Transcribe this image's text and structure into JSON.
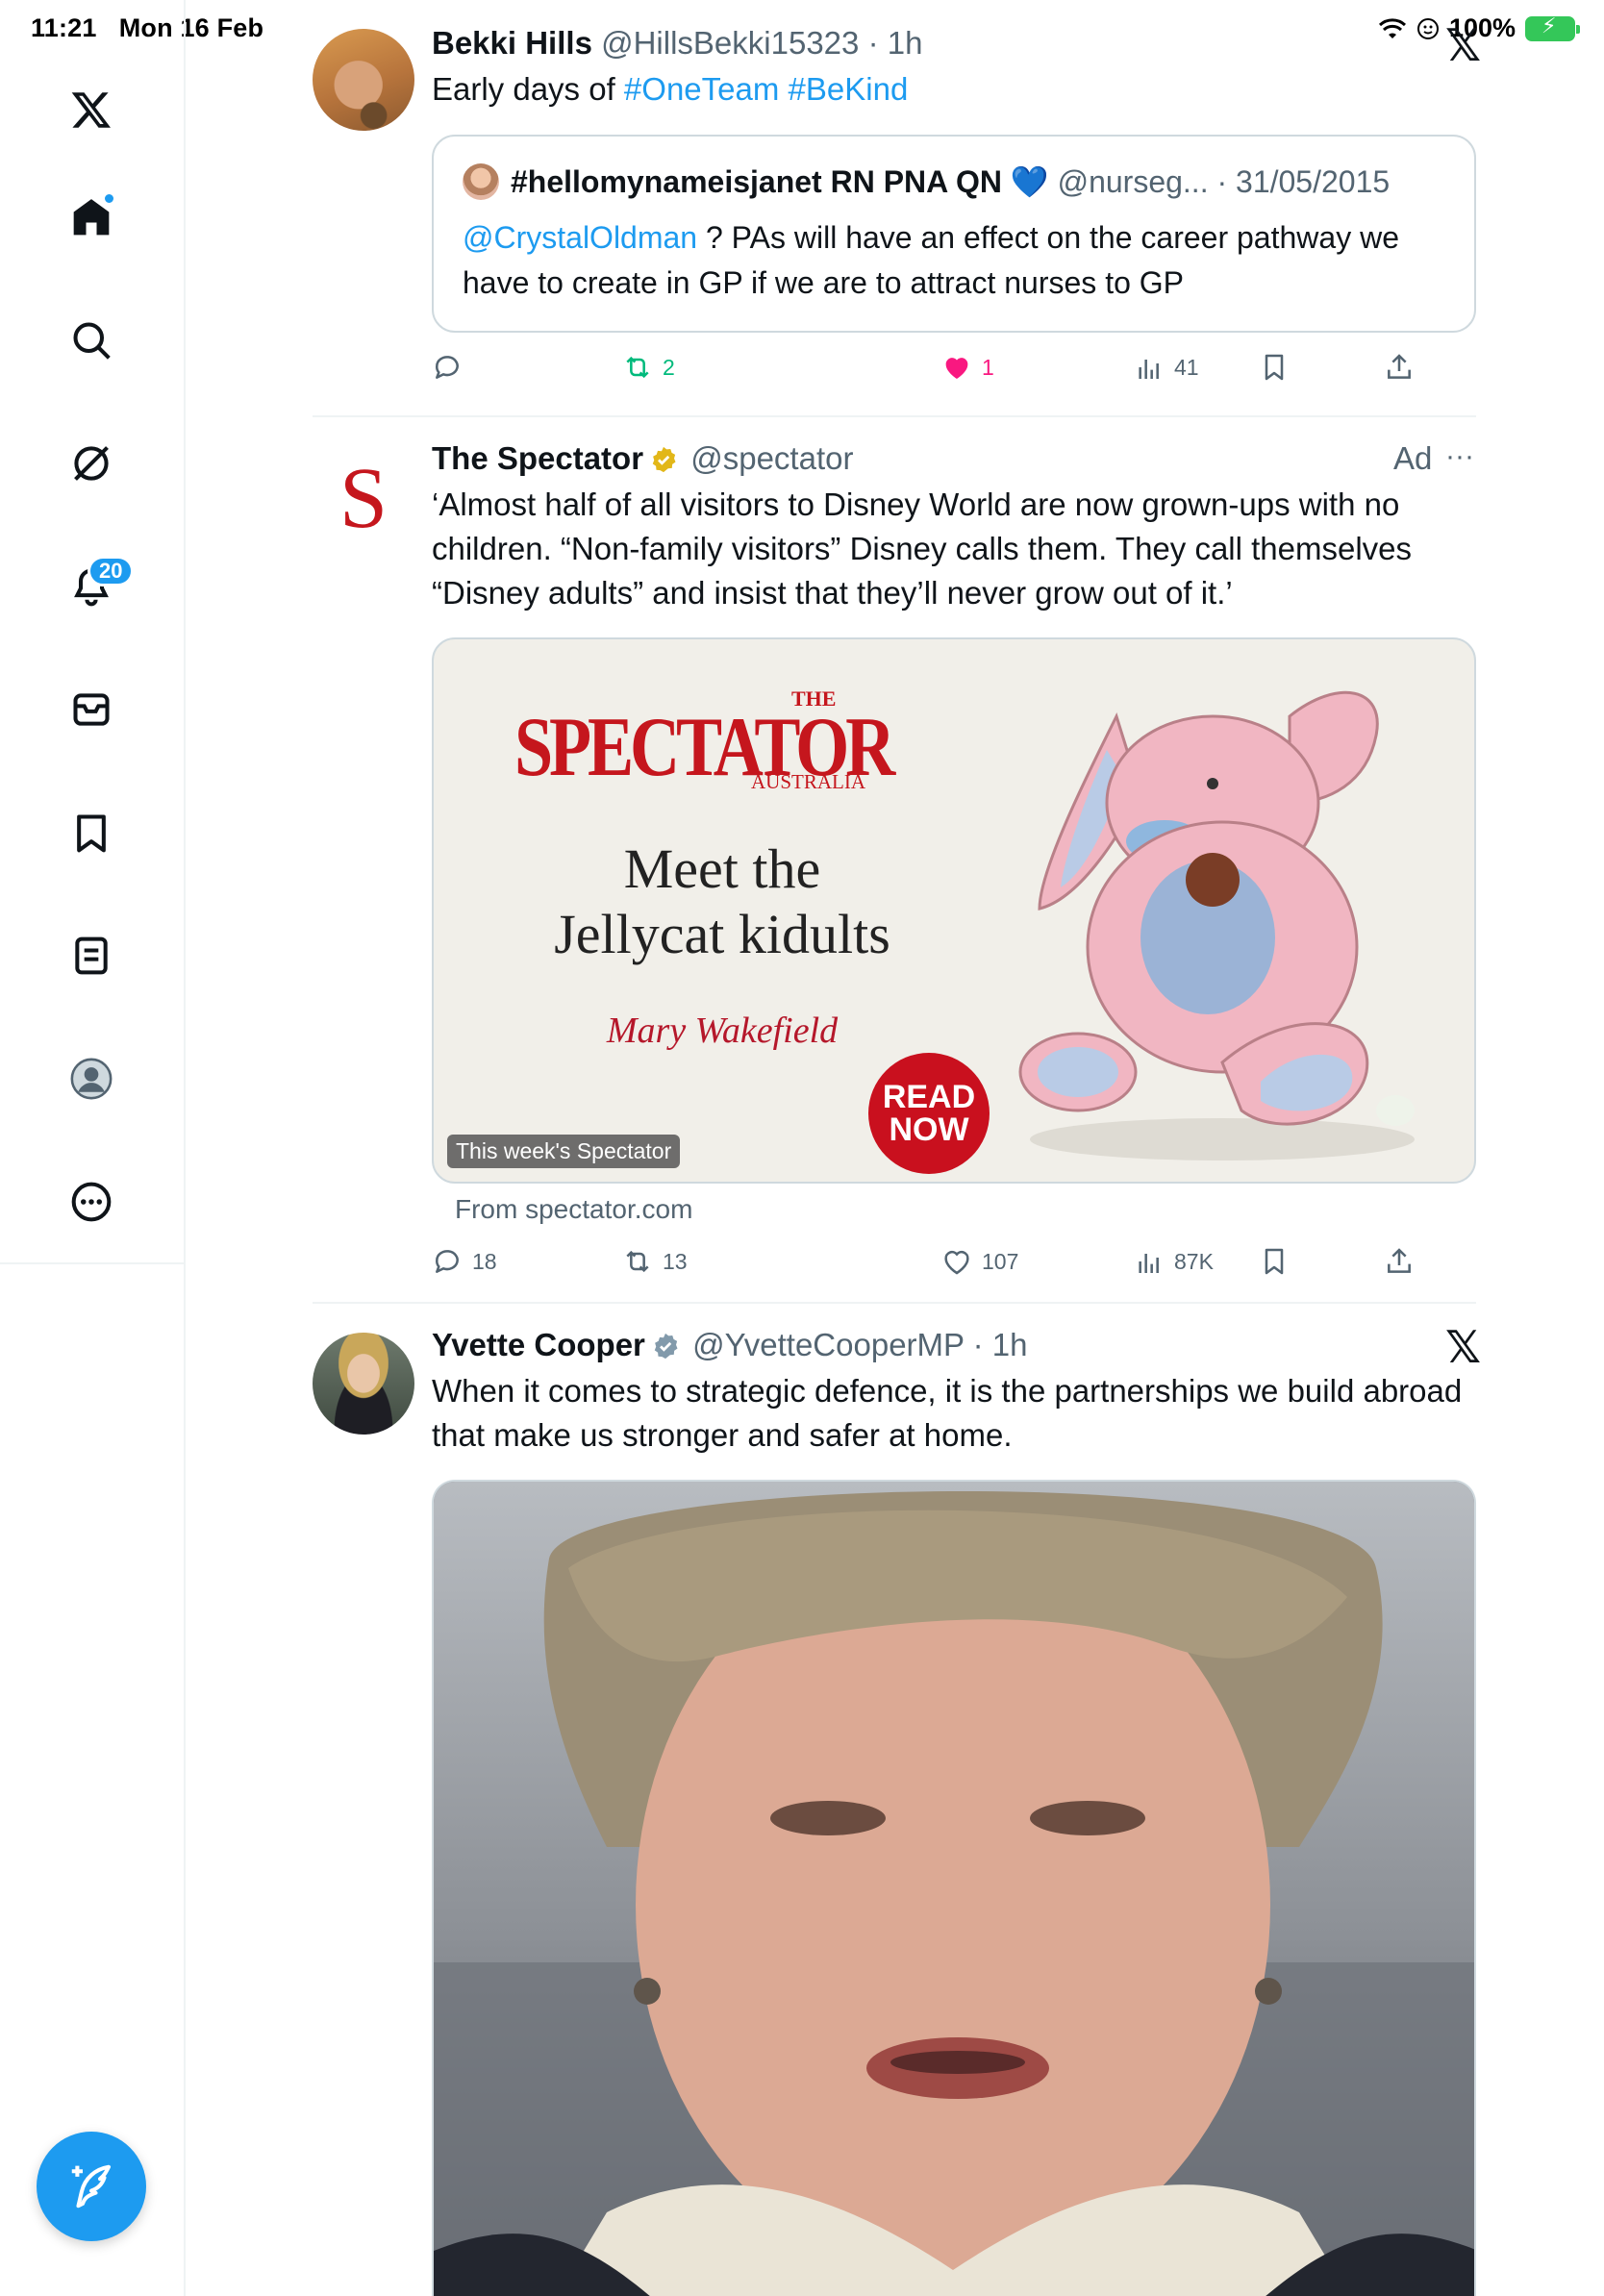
{
  "status_bar": {
    "time": "11:21",
    "date": "Mon 16 Feb",
    "battery": "100%"
  },
  "sidebar": {
    "items": [
      {
        "name": "x-logo"
      },
      {
        "name": "home"
      },
      {
        "name": "explore"
      },
      {
        "name": "grok"
      },
      {
        "name": "notifications",
        "badge": "20"
      },
      {
        "name": "messages"
      },
      {
        "name": "bookmarks"
      },
      {
        "name": "lists"
      },
      {
        "name": "profile"
      },
      {
        "name": "more"
      }
    ],
    "compose_icon": "compose-icon"
  },
  "tweets": [
    {
      "name": "Bekki Hills",
      "handle": "@HillsBekki15323",
      "time": "· 1h",
      "text_prefix": "Early days of ",
      "hashtag1": "#OneTeam",
      "hashtag2": "#BeKind",
      "quote": {
        "name": "#hellomynameisjanet RN PNA QN",
        "heart": "💙",
        "handle": "@nurseg...",
        "date": "· 31/05/2015",
        "mention": "@CrystalOldman",
        "text": " ? PAs will have an effect on the career pathway we have to create in GP if we are to attract nurses to GP"
      },
      "stats": {
        "replies": "",
        "retweets": "2",
        "likes": "1",
        "views": "41"
      }
    },
    {
      "name": "The Spectator",
      "handle": "@spectator",
      "ad_label": "Ad",
      "more": "···",
      "avatar_letter": "S",
      "text": "‘Almost half of all visitors to Disney World are now grown-ups with no children. “Non-family visitors” Disney calls them. They call themselves “Disney adults” and insist that they’ll never grow out of it.’",
      "card": {
        "logo_the": "THE",
        "logo": "SPECTATOR",
        "logo_sub": "AUSTRALIA",
        "title_line1": "Meet the",
        "title_line2": "Jellycat kidults",
        "author": "Mary Wakefield",
        "cta_line1": "READ",
        "cta_line2": "NOW",
        "badge": "This week's Spectator"
      },
      "from": "From spectator.com",
      "stats": {
        "replies": "18",
        "retweets": "13",
        "likes": "107",
        "views": "87K"
      }
    },
    {
      "name": "Yvette Cooper",
      "handle": "@YvetteCooperMP",
      "time": "· 1h",
      "text": "When it comes to strategic defence, it is the partnerships we build abroad that make us stronger and safer at home."
    }
  ],
  "colors": {
    "accent": "#1d9bf0",
    "like": "#f91880",
    "retweet": "#00ba7c",
    "verified": "#e2b719",
    "spectator_red": "#c5161d"
  }
}
